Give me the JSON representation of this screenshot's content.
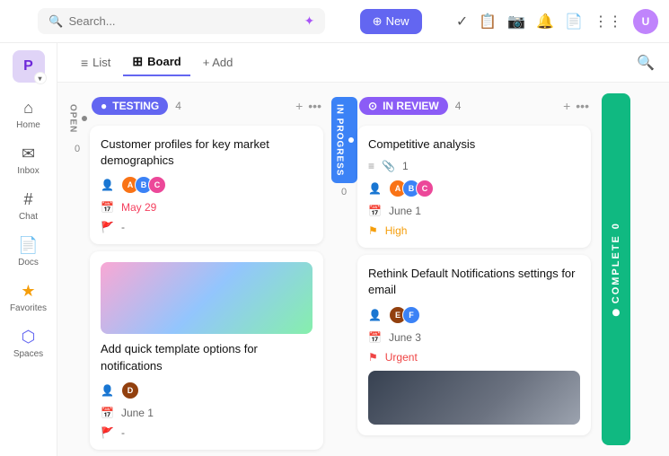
{
  "topbar": {
    "search_placeholder": "Search...",
    "new_button": "New",
    "sparkle_icon": "✦"
  },
  "sidebar": {
    "logo_letter": "P",
    "items": [
      {
        "id": "home",
        "label": "Home",
        "icon": "⌂"
      },
      {
        "id": "inbox",
        "label": "Inbox",
        "icon": "✉"
      },
      {
        "id": "chat",
        "label": "Chat",
        "icon": "#"
      },
      {
        "id": "docs",
        "label": "Docs",
        "icon": "📄"
      },
      {
        "id": "favorites",
        "label": "Favorites",
        "icon": "★"
      },
      {
        "id": "spaces",
        "label": "Spaces",
        "icon": "🟣"
      }
    ]
  },
  "view_header": {
    "tabs": [
      {
        "id": "list",
        "label": "List",
        "icon": "≡"
      },
      {
        "id": "board",
        "label": "Board",
        "icon": "⊞",
        "active": true
      }
    ],
    "add_label": "+ Add"
  },
  "board": {
    "columns": [
      {
        "id": "testing",
        "side_label": "OPEN",
        "side_count": "0",
        "badge_label": "TESTING",
        "badge_dot": "●",
        "count": 4,
        "cards": [
          {
            "id": "card1",
            "title": "Customer profiles for key market demographics",
            "avatars": [
              "#f97316",
              "#3b82f6",
              "#ec4899"
            ],
            "date": "May 29",
            "date_color": "red",
            "flag": "-"
          },
          {
            "id": "card2",
            "title": "Add quick template options for notifications",
            "has_image": true,
            "avatars": [
              "#92400e"
            ],
            "date": "June 1",
            "date_color": "normal",
            "flag": "-"
          }
        ]
      },
      {
        "id": "in_review",
        "side_label": "IN PROGRESS",
        "side_count": "0",
        "badge_label": "IN REVIEW",
        "badge_dot": "⊙",
        "count": 4,
        "cards": [
          {
            "id": "card3",
            "title": "Competitive analysis",
            "lines_count": "1",
            "clip_count": "1",
            "avatars": [
              "#f97316",
              "#3b82f6",
              "#ec4899"
            ],
            "date": "June 1",
            "date_color": "normal",
            "priority": "High",
            "priority_color": "high"
          },
          {
            "id": "card4",
            "title": "Rethink Default Notifications settings for email",
            "avatars": [
              "#92400e",
              "#3b82f6"
            ],
            "date": "June 3",
            "date_color": "normal",
            "priority": "Urgent",
            "priority_color": "urgent",
            "has_dark_image": true
          }
        ]
      }
    ],
    "complete_label": "COMPLETE",
    "complete_count": "0"
  }
}
